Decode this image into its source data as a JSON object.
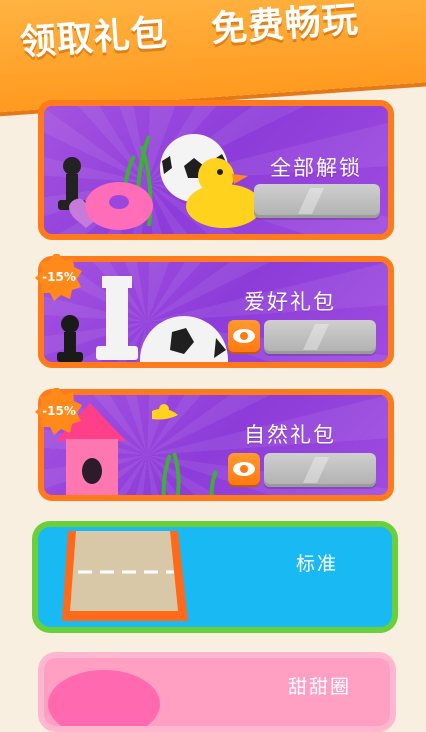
{
  "header": {
    "title_left": "领取礼包",
    "title_right": "免费畅玩"
  },
  "packs": [
    {
      "title": "全部解锁",
      "badge": "",
      "has_ad_button": false
    },
    {
      "title": "爱好礼包",
      "badge": "-15%",
      "has_ad_button": true
    },
    {
      "title": "自然礼包",
      "badge": "-15%",
      "has_ad_button": true
    }
  ],
  "themes": [
    {
      "title": "标准"
    },
    {
      "title": "甜甜圈"
    }
  ],
  "colors": {
    "banner": "#ff9a1f",
    "card_border": "#ff7a1a",
    "card_purple": "#9b47de",
    "standard_border": "#6ad03a",
    "standard_fill": "#19b9f3",
    "donut_fill": "#ff9fc1"
  },
  "icons": [
    "eye-icon",
    "chess-pawn-icon",
    "chess-rook-icon",
    "soccer-ball-icon",
    "rubber-duck-icon",
    "donut-icon",
    "birdhouse-icon",
    "bird-icon",
    "grass-icon"
  ]
}
